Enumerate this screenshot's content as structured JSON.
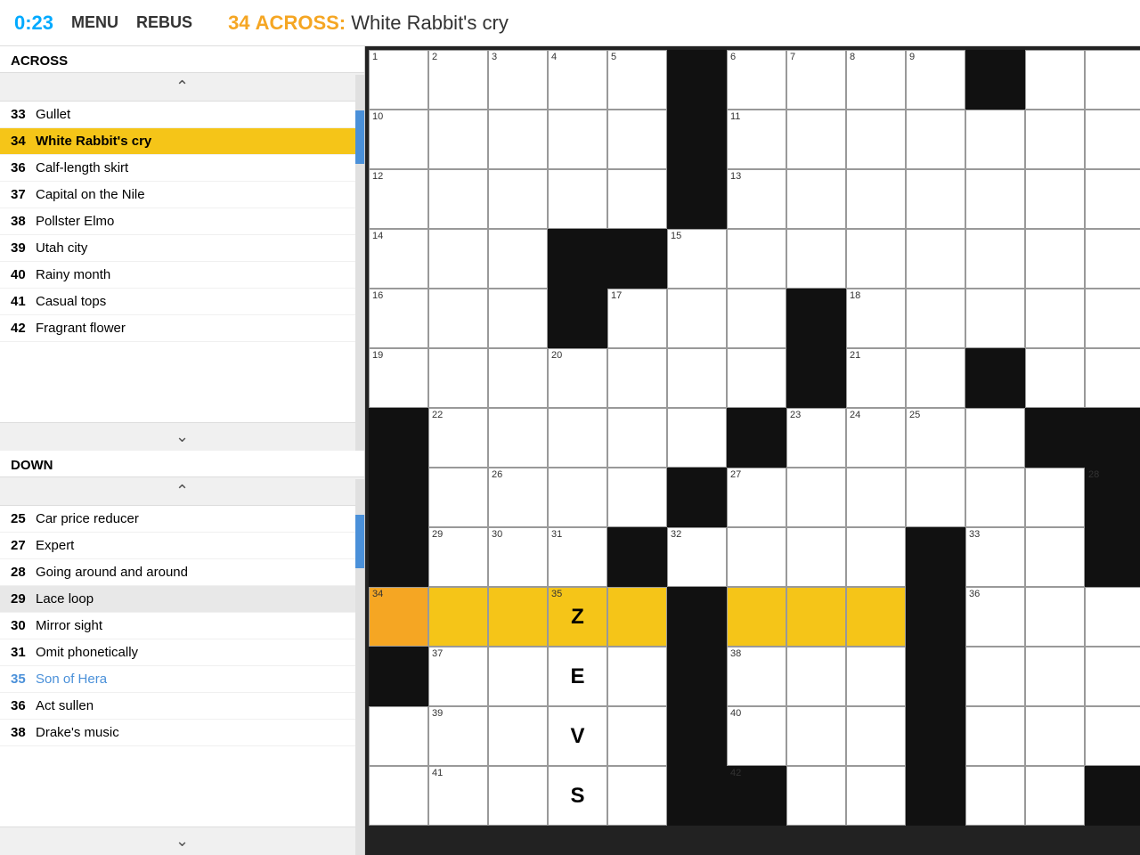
{
  "header": {
    "timer": "0:23",
    "menu_label": "MENU",
    "rebus_label": "REBUS",
    "active_clue_number": "34",
    "active_clue_direction": "ACROSS",
    "active_clue_text": "White Rabbit's cry"
  },
  "sidebar": {
    "across_header": "ACROSS",
    "down_header": "DOWN",
    "across_clues": [
      {
        "number": "33",
        "text": "Gullet",
        "selected": false
      },
      {
        "number": "34",
        "text": "White Rabbit's cry",
        "selected": true
      },
      {
        "number": "36",
        "text": "Calf-length skirt",
        "selected": false
      },
      {
        "number": "37",
        "text": "Capital on the Nile",
        "selected": false
      },
      {
        "number": "38",
        "text": "Pollster Elmo",
        "selected": false
      },
      {
        "number": "39",
        "text": "Utah city",
        "selected": false
      },
      {
        "number": "40",
        "text": "Rainy month",
        "selected": false
      },
      {
        "number": "41",
        "text": "Casual tops",
        "selected": false
      },
      {
        "number": "42",
        "text": "Fragrant flower",
        "selected": false
      }
    ],
    "down_clues": [
      {
        "number": "25",
        "text": "Car price reducer",
        "selected": false
      },
      {
        "number": "27",
        "text": "Expert",
        "selected": false
      },
      {
        "number": "28",
        "text": "Going around and around",
        "selected": false
      },
      {
        "number": "29",
        "text": "Lace loop",
        "selected": false,
        "highlighted": true
      },
      {
        "number": "30",
        "text": "Mirror sight",
        "selected": false
      },
      {
        "number": "31",
        "text": "Omit phonetically",
        "selected": false
      },
      {
        "number": "35",
        "text": "Son of Hera",
        "selected": false,
        "special": true
      },
      {
        "number": "36",
        "text": "Act sullen",
        "selected": false
      },
      {
        "number": "38",
        "text": "Drake's music",
        "selected": false
      }
    ]
  },
  "grid": {
    "cols": 13,
    "rows": 13
  }
}
